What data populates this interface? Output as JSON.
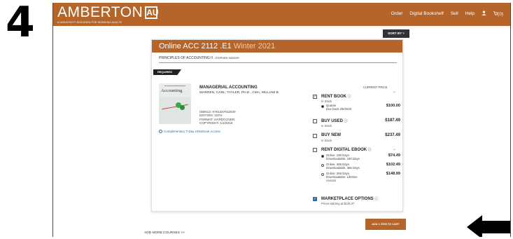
{
  "step_number": "4",
  "brand": {
    "name": "AMBERTON",
    "mark": "AU",
    "tagline": "A UNIVERSITY DESIGNED FOR WORKING ADULTS"
  },
  "nav": {
    "order": "Order",
    "digital_bookshelf": "Digital Bookshelf",
    "sell": "Sell",
    "help": "Help",
    "cart_count": "(0)"
  },
  "sort_by": "SORT BY",
  "course": {
    "code": "Online ACC 2112 .E1",
    "term": "Winter 2021",
    "title": "PRINCIPLES OF ACCOUNTING II",
    "instructor": " - STEPHEN SWIGER",
    "required_label": "REQUIRED"
  },
  "book": {
    "cover_title": "Accounting",
    "title": "MANAGERIAL ACCOUNTING",
    "authors": "WARREN, CARL; TAYLER, PH.D., CMA, WILLIAM B",
    "isbn": "ISBN13: 9781337912020",
    "edition": "EDITION: 15TH",
    "format": "FORMAT: HARDCOVER",
    "copyright": "COPYRIGHT: 1/1/2019",
    "access_link": "Complimentary 7-Day eTextbook Access"
  },
  "current_price_label": "CURRENT PRICE",
  "options": {
    "rent": {
      "label": "RENT BOOK",
      "stock": "In Stock",
      "radio_label": "Quarter",
      "due": "Due back 3/5/2025",
      "price": "$100.00"
    },
    "used": {
      "label": "BUY USED",
      "stock": "In Stock",
      "price": "$187.49"
    },
    "new": {
      "label": "BUY NEW",
      "stock": "In Stock",
      "price": "$237.49"
    },
    "ebook": {
      "label": "RENT DIGITAL EBOOK",
      "items": [
        {
          "line1": "Online: 180 Days",
          "line2": "Downloadable: 180 Days",
          "price": "$74.49"
        },
        {
          "line1": "Online: 365 Days",
          "line2": "Downloadable: 365 Days",
          "price": "$102.49"
        },
        {
          "line1": "Online: 365 Days",
          "line2": "Downloadable: Lifetime",
          "line3": "Access",
          "price": "$148.99"
        }
      ]
    },
    "marketplace": {
      "label": "MARKETPLACE OPTIONS",
      "note": "Prices starting at $135.37"
    }
  },
  "add_to_cart": "ADD 1 ITEM TO CART",
  "add_more_courses": "ADD MORE COURSES >>",
  "colors": {
    "brand": "#b5652a",
    "link": "#2f6ea5",
    "arrow": "#000000"
  },
  "icons": [
    "user-icon",
    "cart-icon",
    "info-icon",
    "chevron-down-icon",
    "clock-icon",
    "arrow-left-icon"
  ]
}
